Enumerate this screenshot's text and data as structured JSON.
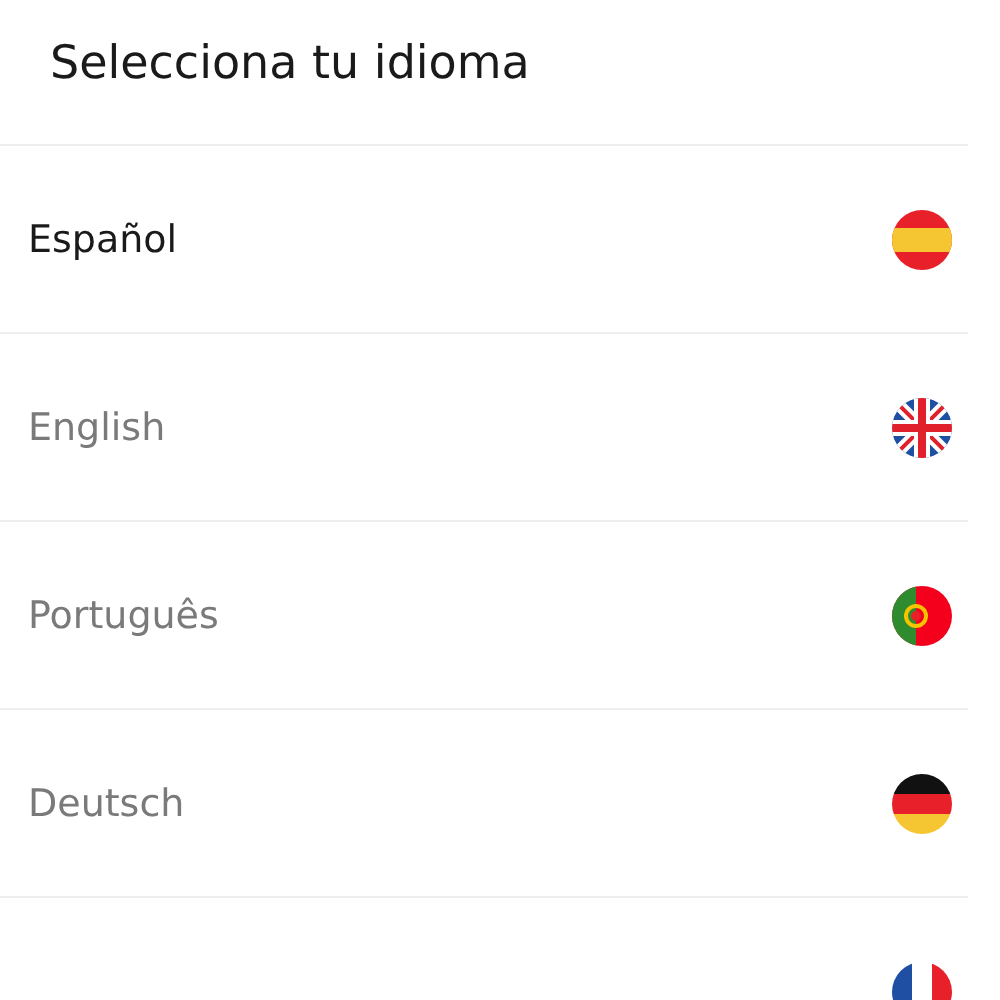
{
  "header": {
    "title": "Selecciona tu idioma"
  },
  "languages": [
    {
      "label": "Español",
      "kind": "es",
      "selected": true
    },
    {
      "label": "English",
      "kind": "gb",
      "selected": false
    },
    {
      "label": "Português",
      "kind": "pt",
      "selected": false
    },
    {
      "label": "Deutsch",
      "kind": "de",
      "selected": false
    },
    {
      "kind": "fr"
    }
  ]
}
